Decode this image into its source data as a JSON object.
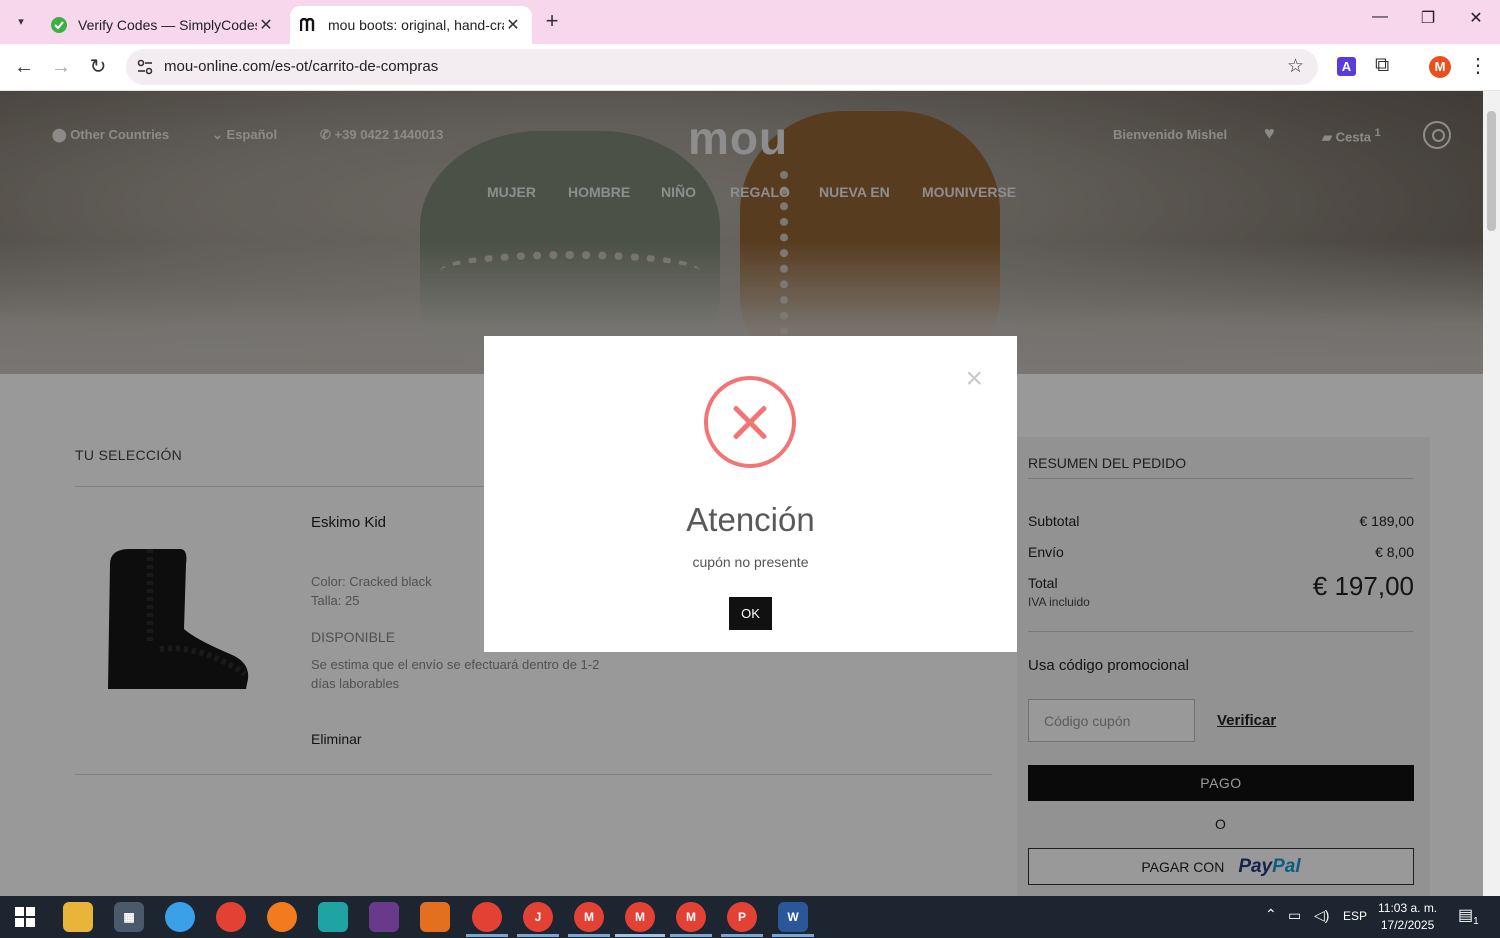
{
  "browser": {
    "tabs": [
      {
        "title": "Verify Codes — SimplyCodes",
        "favicon": "simplycodes-icon",
        "active": false
      },
      {
        "title": "mou boots: original, hand-crafted",
        "favicon": "mou-icon",
        "active": true
      }
    ],
    "url": "mou-online.com/es-ot/carrito-de-compras",
    "profile_initial": "M",
    "extension_letter": "A"
  },
  "header": {
    "country": "Other Countries",
    "language": "Español",
    "phone": "+39 0422 1440013",
    "logo": "mou",
    "welcome": "Bienvenido Mishel",
    "basket_label": "Cesta",
    "basket_count": "1",
    "menu": [
      "MUJER",
      "HOMBRE",
      "NIÑO",
      "REGALO",
      "NUEVA EN",
      "MOUNIVERSE"
    ]
  },
  "cart": {
    "title": "TU SELECCIÓN",
    "product": {
      "name": "Eskimo Kid",
      "color": "Color: Cracked black",
      "size": "Talla: 25",
      "availability": "DISPONIBLE",
      "eta": "Se estima que el envío se efectuará dentro de 1-2 días laborables",
      "remove": "Eliminar"
    }
  },
  "summary": {
    "title": "RESUMEN DEL PEDIDO",
    "subtotal_label": "Subtotal",
    "subtotal": "€ 189,00",
    "shipping_label": "Envío",
    "shipping": "€ 8,00",
    "total_label": "Total",
    "total": "€ 197,00",
    "vat_note": "IVA incluido",
    "promo_label": "Usa código promocional",
    "coupon_placeholder": "Código cupón",
    "verify_label": "Verificar",
    "pay_label": "PAGO",
    "or_label": "O",
    "paypal_label": "PAGAR CON",
    "paypal_brand_1": "Pay",
    "paypal_brand_2": "Pal"
  },
  "modal": {
    "title": "Atención",
    "message": "cupón no presente",
    "ok": "OK",
    "close": "×"
  },
  "taskbar": {
    "language": "ESP",
    "time": "11:03 a. m.",
    "date": "17/2/2025",
    "notifications": "1"
  },
  "colors": {
    "error": "#f27474",
    "tabbar": "#f7d7ec",
    "pay_button": "#111111",
    "paypal_blue": "#253b80"
  }
}
